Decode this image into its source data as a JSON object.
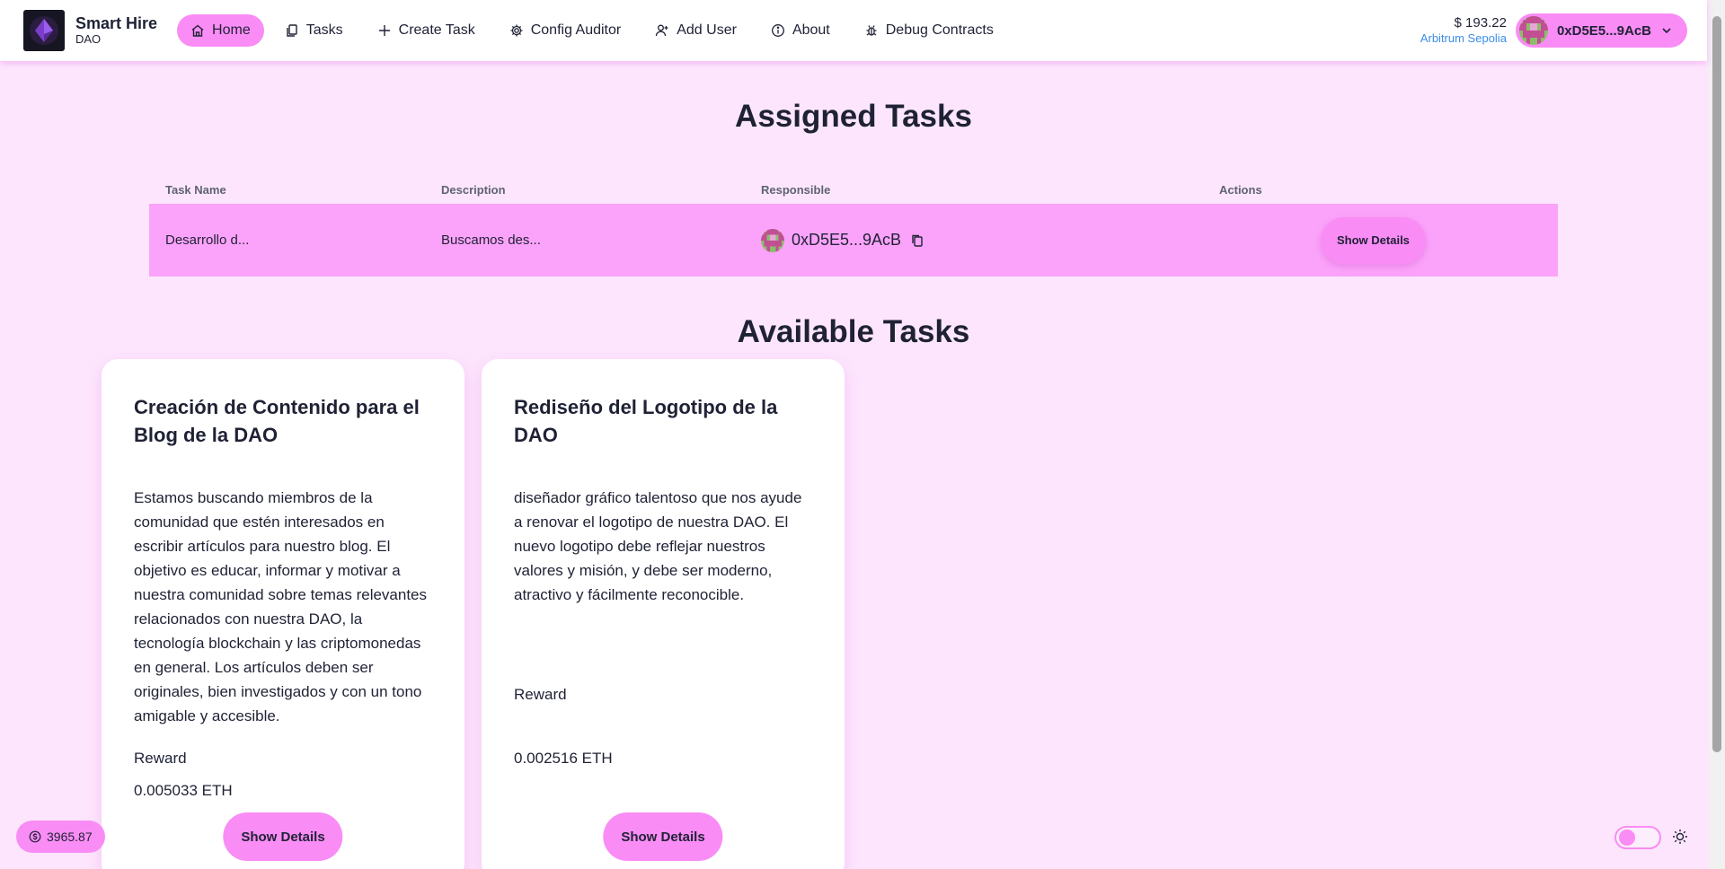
{
  "brand": {
    "title": "Smart Hire",
    "subtitle": "DAO"
  },
  "nav": {
    "items": [
      {
        "label": "Home",
        "icon": "home-icon",
        "active": true
      },
      {
        "label": "Tasks",
        "icon": "documents-icon"
      },
      {
        "label": "Create Task",
        "icon": "plus-icon"
      },
      {
        "label": "Config Auditor",
        "icon": "gear-icon"
      },
      {
        "label": "Add User",
        "icon": "user-plus-icon"
      },
      {
        "label": "About",
        "icon": "info-icon"
      },
      {
        "label": "Debug Contracts",
        "icon": "bug-icon"
      }
    ]
  },
  "wallet": {
    "balance_usd": "$ 193.22",
    "network": "Arbitrum Sepolia",
    "address": "0xD5E5...9AcB"
  },
  "assigned": {
    "title": "Assigned Tasks",
    "columns": [
      "Task Name",
      "Description",
      "Responsible",
      "Actions"
    ],
    "rows": [
      {
        "name": "Desarrollo d...",
        "description": "Buscamos des...",
        "responsible": "0xD5E5...9AcB",
        "action": "Show Details"
      }
    ]
  },
  "available": {
    "title": "Available Tasks",
    "cards": [
      {
        "title": "Creación de Contenido para el Blog de la DAO",
        "description": "Estamos buscando miembros de la comunidad que estén interesados en escribir artículos para nuestro blog. El objetivo es educar, informar y motivar a nuestra comunidad sobre temas relevantes relacionados con nuestra DAO, la tecnología blockchain y las criptomonedas en general. Los artículos deben ser originales, bien investigados y con un tono amigable y accesible.",
        "reward_label": "Reward",
        "reward_value": "0.005033 ETH",
        "button": "Show Details"
      },
      {
        "title": "Rediseño del Logotipo de la DAO",
        "description": "diseñador gráfico talentoso que nos ayude a renovar el logotipo de nuestra DAO. El nuevo logotipo debe reflejar nuestros valores y misión, y debe ser moderno, atractivo y fácilmente reconocible.",
        "reward_label": "Reward",
        "reward_value": "0.002516 ETH",
        "button": "Show Details"
      }
    ]
  },
  "faucet": {
    "price": "3965.87"
  },
  "colors": {
    "accent": "#f98cf5",
    "background": "#fde6fd",
    "row": "#fba3fa",
    "network": "#3b8ee8"
  }
}
